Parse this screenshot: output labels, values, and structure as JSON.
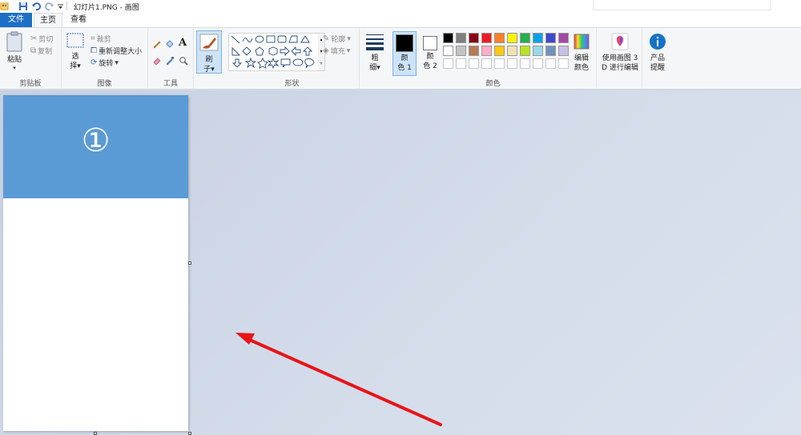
{
  "window": {
    "title": "幻灯片1.PNG - 画图"
  },
  "tabs": [
    {
      "label": "文件"
    },
    {
      "label": "主页"
    },
    {
      "label": "查看"
    }
  ],
  "groups": {
    "clipboard": {
      "label": "剪贴板",
      "paste": "粘贴",
      "cut": "剪切",
      "copy": "复制"
    },
    "image": {
      "label": "图像",
      "select_1": "选",
      "select_2": "择",
      "crop": "裁剪",
      "resize": "重新调整大小",
      "rotate": "旋转"
    },
    "tools": {
      "label": "工具"
    },
    "brushes": {
      "label_1": "刷",
      "label_2": "子"
    },
    "shapes": {
      "label": "形状",
      "outline": "轮廓",
      "fill": "填充"
    },
    "size": {
      "label_1": "粗",
      "label_2": "细"
    },
    "colors": {
      "label": "颜色",
      "color1_1": "颜",
      "color1_2": "色 1",
      "color2_1": "颜",
      "color2_2": "色 2",
      "edit_1": "编辑",
      "edit_2": "颜色",
      "color1_value": "#000000",
      "color2_value": "#ffffff",
      "palette_row1": [
        "#000000",
        "#7f7f7f",
        "#880015",
        "#ed1c24",
        "#ff7f27",
        "#fff200",
        "#22b14c",
        "#00a2e8",
        "#3f48cc",
        "#a349a4"
      ],
      "palette_row2": [
        "#ffffff",
        "#c3c3c3",
        "#b97a57",
        "#ffaec9",
        "#ffc90e",
        "#efe4b0",
        "#b5e61d",
        "#99d9ea",
        "#7092be",
        "#c8bfe7"
      ]
    },
    "paint3d": {
      "label_1": "使用画图 3",
      "label_2": "D 进行编辑"
    },
    "alerts": {
      "label_1": "产品",
      "label_2": "提醒"
    }
  },
  "canvas": {
    "slide_number": "①",
    "header_color": "#5b9bd5"
  },
  "annotation": {
    "arrow_color": "#e81416"
  }
}
